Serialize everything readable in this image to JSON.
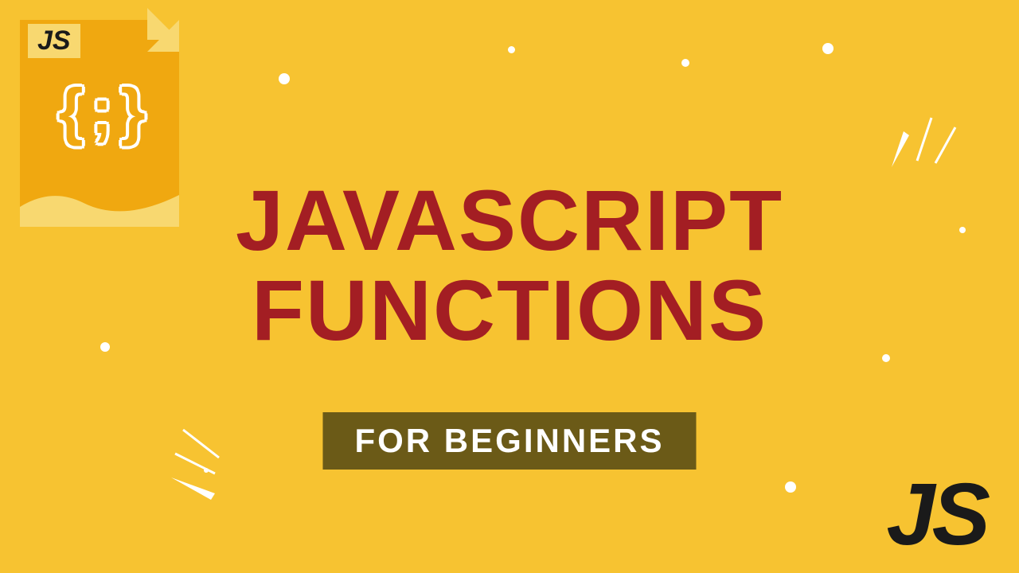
{
  "file_icon": {
    "badge": "JS",
    "braces": "{ ; }"
  },
  "title": {
    "line1": "JAVASCRIPT",
    "line2": "FUNCTIONS"
  },
  "subtitle": "FOR BEGINNERS",
  "corner_mark": "JS",
  "colors": {
    "background": "#f7c331",
    "title": "#a31e23",
    "subtitle_bg": "#6b5a17",
    "file_bg": "#f0a810"
  }
}
